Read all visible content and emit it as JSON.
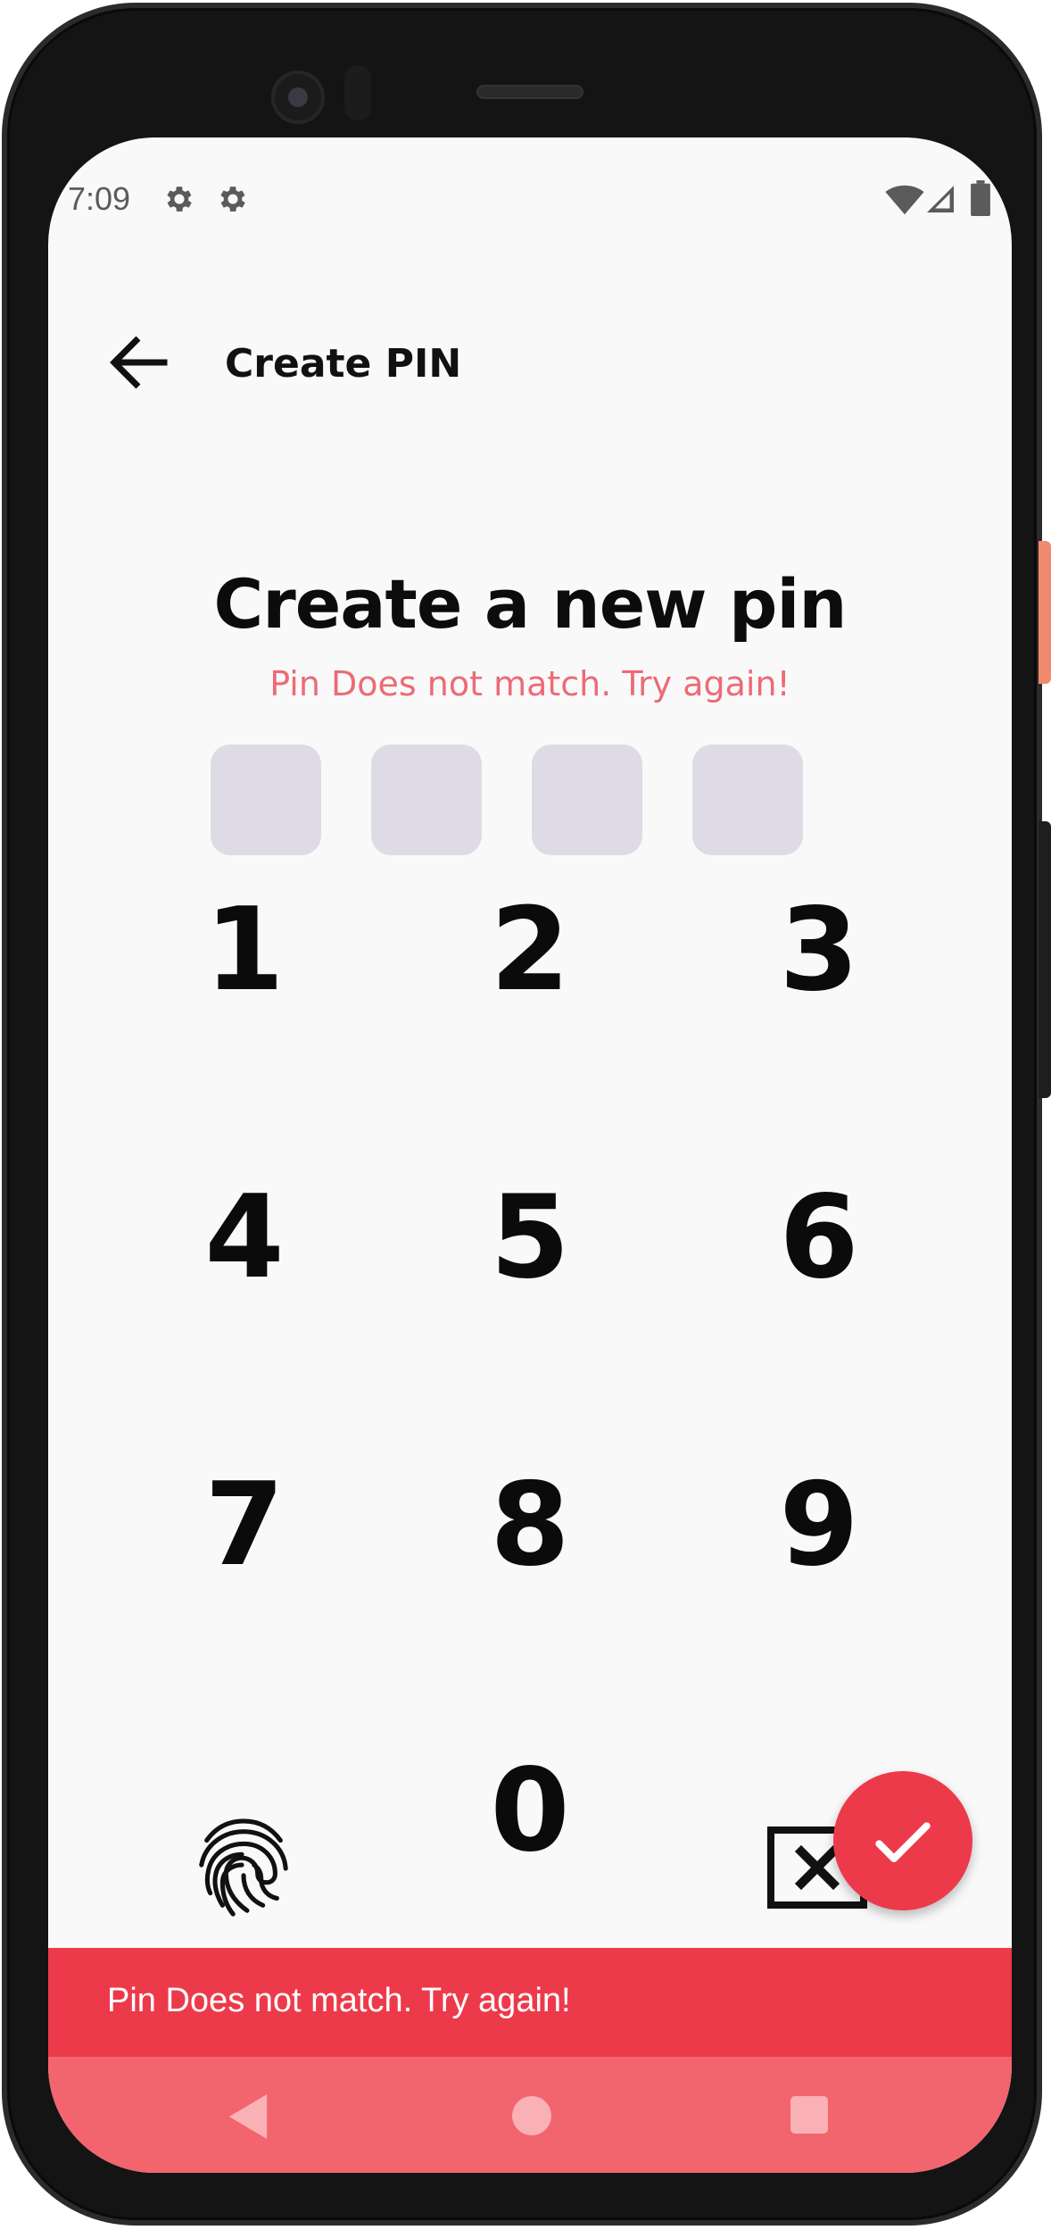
{
  "status_bar": {
    "time": "7:09",
    "icons": [
      "gear-icon",
      "gear-icon",
      "wifi-icon",
      "signal-icon",
      "battery-icon"
    ]
  },
  "app_bar": {
    "back_icon": "arrow-left-icon",
    "title": "Create PIN"
  },
  "main": {
    "heading": "Create a new pin",
    "error_message": "Pin Does not match. Try again!",
    "pin_length": 4
  },
  "keypad": {
    "keys": [
      "1",
      "2",
      "3",
      "4",
      "5",
      "6",
      "7",
      "8",
      "9",
      "0"
    ],
    "fingerprint_icon": "fingerprint-icon",
    "backspace_icon": "backspace-icon"
  },
  "fab": {
    "icon": "check-icon",
    "color": "#ed3a4b"
  },
  "snackbar": {
    "message": "Pin Does not match. Try again!",
    "color": "#ed3a4b"
  },
  "nav_bar": {
    "icons": [
      "nav-back-icon",
      "nav-home-icon",
      "nav-recents-icon"
    ],
    "color": "#f2646e"
  },
  "colors": {
    "accent": "#ed3a4b",
    "error_text": "#ec6b76",
    "pin_box": "#dedbe7",
    "background": "#f9f9f9"
  }
}
